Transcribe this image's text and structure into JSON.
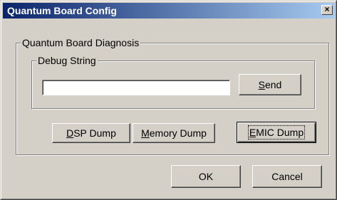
{
  "window": {
    "title": "Quantum Board Config",
    "close_glyph": "×"
  },
  "diagnosis_group": {
    "label": "Quantum Board Diagnosis"
  },
  "debug_group": {
    "label": "Debug String",
    "input_value": "",
    "send_label": "Send"
  },
  "dump_buttons": {
    "dsp_label": "DSP Dump",
    "memory_label": "Memory Dump",
    "emic_label": "EMIC Dump"
  },
  "dialog_buttons": {
    "ok_label": "OK",
    "cancel_label": "Cancel"
  },
  "colors": {
    "title_bar_start": "#0a246a",
    "title_bar_end": "#a6caf0",
    "face": "#d4d0c8"
  },
  "icons": {
    "close": "close-icon"
  }
}
